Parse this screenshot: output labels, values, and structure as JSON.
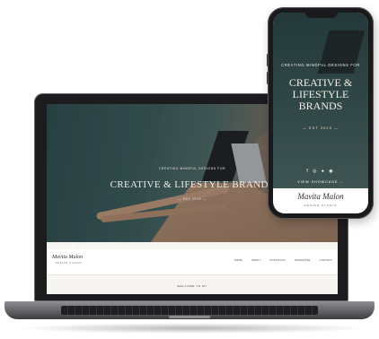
{
  "laptop": {
    "hero": {
      "tagline_small": "CREATING MINDFUL DESIGNS FOR",
      "tagline_big": "CREATIVE & LIFESTYLE BRANDS",
      "established": "— EST 2015 —"
    },
    "socials": [
      "f",
      "◎",
      "●",
      "◉"
    ],
    "showcase_link": "VIEW SHOWCASE →",
    "brand": {
      "logo": "Mavita Malon",
      "sub": "DESIGN STUDIO"
    },
    "nav_items": [
      "HOME",
      "ABOUT",
      "PORTFOLIO",
      "SHOWCASE",
      "CONTACT"
    ],
    "welcome": "WELCOME TO MY"
  },
  "phone": {
    "tagline_small": "CREATING MINDFUL DESIGNS FOR",
    "tagline_big": "CREATIVE & LIFESTYLE BRANDS",
    "established": "— EST 2015 —",
    "socials": "f ◎ ● ◉",
    "cta": "VIEW SHOWCASE →",
    "brand": {
      "logo": "Mavita Malon",
      "sub": "DESIGN STUDIO"
    }
  },
  "colors": {
    "hero_teal": "#3c5a5b",
    "deck_tan": "#b58d73",
    "device_dark": "#1c1c1e",
    "text_light": "#f2eee9"
  }
}
